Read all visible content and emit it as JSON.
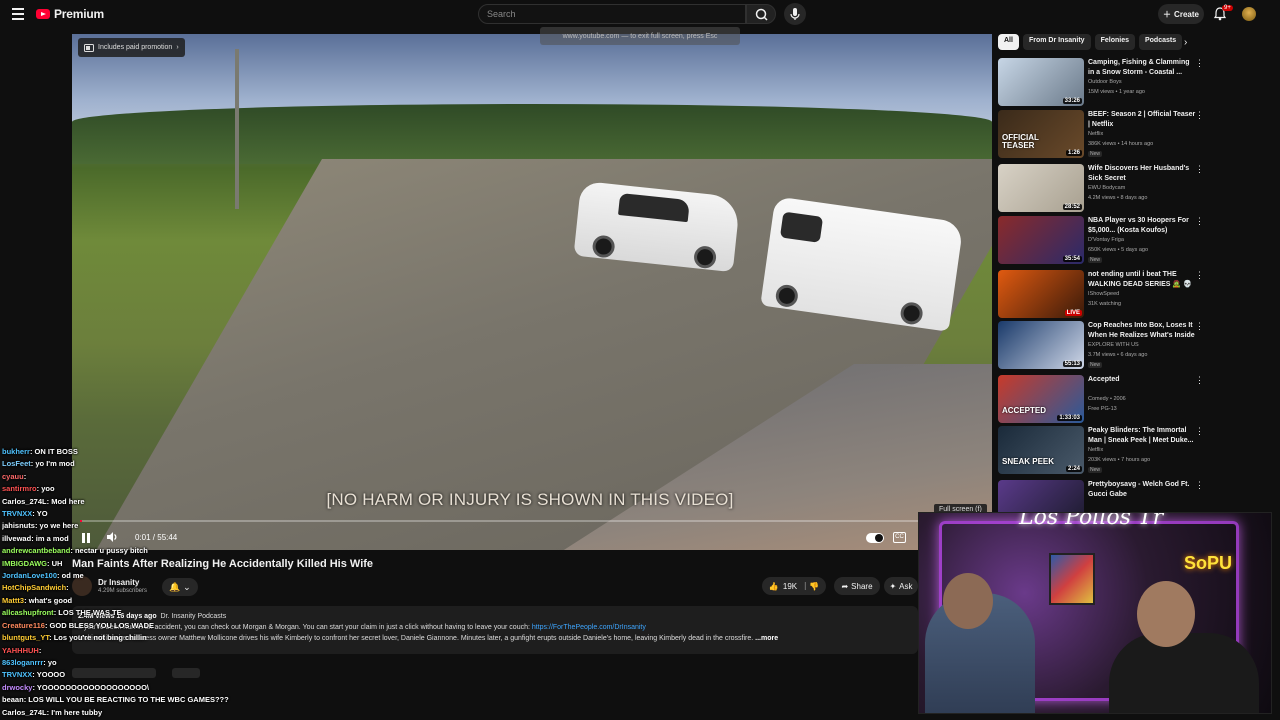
{
  "header": {
    "logo_text": "Premium",
    "search_placeholder": "Search",
    "create_label": "Create",
    "notifications_count": "9+"
  },
  "player": {
    "promo_badge": "Includes paid promotion",
    "fullscreen_hint": "www.youtube.com — to exit full screen, press Esc",
    "caption": "[NO HARM OR INJURY IS SHOWN IN THIS VIDEO]",
    "time_current": "0:01",
    "time_total": "55:44",
    "time_display": "0:01 / 55:44",
    "progress_fraction": 0.0003,
    "fullscreen_tooltip": "Full screen (f)"
  },
  "video": {
    "title": "Man Faints After Realizing He Accidentally Killed His Wife",
    "channel": "Dr Insanity",
    "subscribers": "4.29M subscribers",
    "likes": "19K",
    "share_label": "Share",
    "ask_label": "Ask",
    "desc_meta": "2.4M views  16 days ago",
    "desc_tag": "Dr. Insanity Podcasts",
    "desc_line1": "If you've been hurt in an accident, you can check out Morgan & Morgan. You can start your claim in just a click without having to leave your couch: ",
    "desc_link": "https://ForThePeople.com/DrInsanity",
    "desc_line2": "Multi-millionaire business owner Matthew Mollicone drives his wife Kimberly to confront her secret lover, Daniele Giannone. Minutes later, a gunfight erupts outside Daniele's home, leaving Kimberly dead in the crossfire.",
    "more_label": "...more"
  },
  "chat": [
    {
      "user": "bukherr",
      "msg": "ON IT BOSS",
      "color": "#4fc3ff"
    },
    {
      "user": "LosFeet",
      "msg": "yo I'm mod",
      "color": "#7fd0ff"
    },
    {
      "user": "cyauu",
      "msg": "",
      "color": "#ff6a6a"
    },
    {
      "user": "santirmro",
      "msg": "yoo",
      "color": "#ff5252"
    },
    {
      "user": "Carlos_274L",
      "msg": "Mod here",
      "color": "#ffffff"
    },
    {
      "user": "TRVNXX",
      "msg": "YO",
      "color": "#4fc3ff"
    },
    {
      "user": "jahisnuts",
      "msg": "yo we here",
      "color": "#ffffff"
    },
    {
      "user": "illvewad",
      "msg": "im a mod",
      "color": "#ffffff"
    },
    {
      "user": "andrewcantbeband",
      "msg": "nectar u pussy bitch",
      "color": "#9bff5e"
    },
    {
      "user": "IMBIGDAWG",
      "msg": "UH",
      "color": "#9bff5e"
    },
    {
      "user": "JordanLove100",
      "msg": "od me",
      "color": "#4fc3ff"
    },
    {
      "user": "HotChipSandwich",
      "msg": "",
      "color": "#ffcc33"
    },
    {
      "user": "Mattt3",
      "msg": "what's good",
      "color": "#ffcc33"
    },
    {
      "user": "allcashupfront",
      "msg": "LOS THE WAS TE",
      "color": "#9bff5e"
    },
    {
      "user": "Creature116",
      "msg": "GOD BLESS YOU LOS WADE",
      "color": "#ff8a5e"
    },
    {
      "user": "bluntguts_YT",
      "msg": "Los you're not bing chillin",
      "color": "#ffcc33"
    },
    {
      "user": "YAHHHUH",
      "msg": "",
      "color": "#ff5252"
    },
    {
      "user": "863loganrrr",
      "msg": "yo",
      "color": "#4fc3ff"
    },
    {
      "user": "TRVNXX",
      "msg": "YOOOO",
      "color": "#4fc3ff"
    },
    {
      "user": "drwocky",
      "msg": "YOOOOOOOOOOOOOOOOOO\\",
      "color": "#c48cff"
    },
    {
      "user": "beaan",
      "msg": "LOS WILL YOU BE REACTING TO THE WBC GAMES???",
      "color": "#ffffff"
    },
    {
      "user": "Carlos_274L",
      "msg": "I'm here tubby",
      "color": "#ffffff"
    }
  ],
  "sidebar": {
    "chips": [
      "All",
      "From Dr Insanity",
      "Felonies",
      "Podcasts"
    ],
    "items": [
      {
        "title": "Camping, Fishing & Clamming in a Snow Storm - Coastal ...",
        "channel": "Outdoor Boys",
        "meta": "15M views • 1 year ago",
        "duration": "33:26",
        "badge": "",
        "thumb": [
          "#c7d6e6",
          "#6b7a8a"
        ]
      },
      {
        "title": "BEEF: Season 2 | Official Teaser | Netflix",
        "channel": "Netflix",
        "meta": "386K views • 14 hours ago",
        "duration": "1:26",
        "badge": "New",
        "thumb_text": "OFFICIAL TEASER",
        "thumb": [
          "#3a2a1a",
          "#6a4a2a"
        ]
      },
      {
        "title": "Wife Discovers Her Husband's Sick Secret",
        "channel": "EWU Bodycam",
        "meta": "4.2M views • 8 days ago",
        "duration": "28:52",
        "badge": "",
        "thumb": [
          "#d8d2c6",
          "#a8a090"
        ]
      },
      {
        "title": "NBA Player vs 30 Hoopers For $5,000... (Kosta Koufos)",
        "channel": "D'Vontay Friga",
        "meta": "650K views • 5 days ago",
        "duration": "35:54",
        "badge": "New",
        "thumb": [
          "#8a2a2a",
          "#2a2a6a"
        ]
      },
      {
        "title": "not ending until i beat THE WALKING DEAD SERIES 🧟 💀",
        "channel": "IShowSpeed",
        "meta": "31K watching",
        "duration": "LIVE",
        "badge": "",
        "thumb": [
          "#e05a10",
          "#3a1a0a"
        ]
      },
      {
        "title": "Cop Reaches Into Box, Loses It When He Realizes What's Inside",
        "channel": "EXPLORE WITH US",
        "meta": "3.7M views • 6 days ago",
        "duration": "55:13",
        "badge": "New",
        "thumb": [
          "#1a3a6a",
          "#d0d8e8"
        ]
      },
      {
        "title": "Accepted",
        "channel": "Comedy • 2006",
        "meta": "Free  PG-13",
        "duration": "1:33:03",
        "badge": "",
        "thumb_text": "ACCEPTED",
        "thumb": [
          "#c83a2a",
          "#2a5a9a"
        ]
      },
      {
        "title": "Peaky Blinders: The Immortal Man | Sneak Peek | Meet Duke...",
        "channel": "Netflix",
        "meta": "203K views • 7 hours ago",
        "duration": "2:24",
        "badge": "New",
        "thumb_text": "SNEAK PEEK",
        "thumb": [
          "#1a2a3a",
          "#4a5a6a"
        ]
      },
      {
        "title": "Prettyboysavg - Welch God Ft. Gucci Gabe",
        "channel": "",
        "meta": "",
        "duration": "",
        "badge": "",
        "thumb": [
          "#5a3a8a",
          "#1a1a2a"
        ]
      }
    ]
  },
  "webcam": {
    "neon_sign": "Los Pollos Tr",
    "yellow_sign": "SoPU"
  },
  "colors": {
    "brand_red": "#ff0033",
    "link_blue": "#3ea6ff",
    "background": "#0f0f0f"
  }
}
